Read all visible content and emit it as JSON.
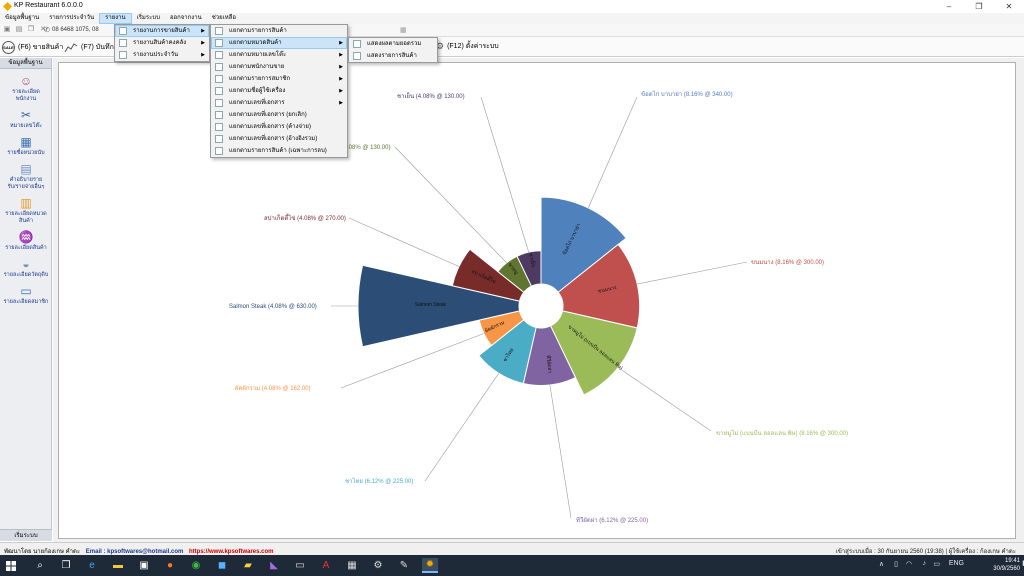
{
  "window": {
    "title": "KP Restaurant 6.0.0.0",
    "controls": [
      "–",
      "❐",
      "✕"
    ]
  },
  "menu": {
    "items": [
      "ข้อมูลพื้นฐาน",
      "รายการประจำวัน",
      "รายงาน",
      "เริ่มระบบ",
      "ออกจากงาน",
      "ช่วยเหลือ"
    ],
    "active_index": 2
  },
  "toolbar": {
    "phone": "08 6468 1075, 08",
    "f6_label": "(F6) ขายสินค้า",
    "f7_label": "(F7) บันทึก",
    "f12_label": "(F12) ตั้งค่าระบบ",
    "sale_badge": "SALE"
  },
  "report_menu": {
    "items": [
      {
        "label": "รายงานการขายสินค้า",
        "has_sub": true,
        "highlighted": true
      },
      {
        "label": "รายงานสินค้าคงคลัง",
        "has_sub": true,
        "highlighted": false
      },
      {
        "label": "รายงานประจำวัน",
        "has_sub": true,
        "highlighted": false
      }
    ]
  },
  "sales_menu": {
    "items": [
      {
        "label": "แยกตามรายการสินค้า",
        "has_sub": false,
        "highlighted": false
      },
      {
        "label": "แยกตามหมวดสินค้า",
        "has_sub": true,
        "highlighted": true
      },
      {
        "label": "แยกตามหมายเลขโต๊ะ",
        "has_sub": true,
        "highlighted": false
      },
      {
        "label": "แยกตามพนักงานขาย",
        "has_sub": true,
        "highlighted": false
      },
      {
        "label": "แยกตามรายการสมาชิก",
        "has_sub": true,
        "highlighted": false
      },
      {
        "label": "แยกตามชื่อผู้ใช้เครื่อง",
        "has_sub": true,
        "highlighted": false
      },
      {
        "label": "แยกตามเลขที่เอกสาร",
        "has_sub": true,
        "highlighted": false
      },
      {
        "label": "แยกตามเลขที่เอกสาร (ยกเลิก)",
        "has_sub": false,
        "highlighted": false
      },
      {
        "label": "แยกตามเลขที่เอกสาร (ค้างจ่าย)",
        "has_sub": false,
        "highlighted": false
      },
      {
        "label": "แยกตามเลขที่เอกสาร (อ้างอิงรวม)",
        "has_sub": false,
        "highlighted": false
      },
      {
        "label": "แยกตามรายการสินค้า (เฉพาะการลบ)",
        "has_sub": false,
        "highlighted": false
      }
    ]
  },
  "category_menu": {
    "items": [
      "แสดงผลตามยอดรวม",
      "แสดงรายการสินค้า"
    ]
  },
  "sidebar": {
    "header": "ข้อมูลพื้นฐาน",
    "items": [
      {
        "label": "รายละเอียด\nพนักงาน",
        "icon": "chef-icon"
      },
      {
        "label": "หมายเลขโต๊ะ",
        "icon": "utensils-icon"
      },
      {
        "label": "รายชื่อหน่วยนับ",
        "icon": "blocks-icon"
      },
      {
        "label": "คำอธิบายราย\nรับ/รายจ่ายอื่นๆ",
        "icon": "note-icon"
      },
      {
        "label": "รายละเอียดหมวด\nสินค้า",
        "icon": "folders-icon"
      },
      {
        "label": "รายละเอียดสินค้า",
        "icon": "wine-icon"
      },
      {
        "label": "รายละเอียดวัตถุดิบ",
        "icon": "bowl-icon"
      },
      {
        "label": "รายละเอียดสมาชิก",
        "icon": "card-icon"
      }
    ],
    "footer": "เริ่มระบบ"
  },
  "chart_data": {
    "type": "pie",
    "variant": "polar-area",
    "slices": [
      {
        "name": "ข้อดไก่ บาบาย่า",
        "percent": 8.16,
        "value": 340.0,
        "label": "ข้อดไก่ บาบาย่า (8.16% @ 340.00)",
        "color": "#4f81bd"
      },
      {
        "name": "ขนมนาง",
        "percent": 8.16,
        "value": 300.0,
        "label": "ขนมนาง (8.16% @ 300.00)",
        "color": "#c0504d"
      },
      {
        "name": "ขาหมูไม่ (แบนบีน ลอลแลน พิษ)",
        "percent": 8.16,
        "value": 300.0,
        "label": "ขาหมูไม่ (แบนบีน ลอลแลน พิษ) (8.16% @ 300.00)",
        "color": "#9bbb59"
      },
      {
        "name": "ทีวีผัดผ่า",
        "percent": 6.12,
        "value": 225.0,
        "label": "ทีวีผัดผ่า (6.12% @ 225.00)",
        "color": "#8064a2"
      },
      {
        "name": "ชาไทย",
        "percent": 6.12,
        "value": 225.0,
        "label": "ชาไทย (6.12% @ 225.00)",
        "color": "#4bacc6"
      },
      {
        "name": "ผัดผักรวม",
        "percent": 4.08,
        "value": 162.0,
        "label": "ผัดผักรวม (4.08% @ 162.00)",
        "color": "#f79646"
      },
      {
        "name": "Salmon Steak",
        "percent": 4.08,
        "value": 630.0,
        "label": "Salmon Steak (4.08% @ 630.00)",
        "color": "#2c4d75"
      },
      {
        "name": "สปาเก็ตตี้ไข่",
        "percent": 4.08,
        "value": 270.0,
        "label": "สปาเก็ตตี้ไข่ (4.08% @ 270.00)",
        "color": "#772c2a"
      },
      {
        "name": "ขาหมู",
        "percent": 4.08,
        "value": 130.0,
        "label": ".08% @ 130.00)",
        "color": "#5f7530"
      },
      {
        "name": "ชาเย็น",
        "percent": 4.08,
        "value": 130.0,
        "label": "ชาเย็น (4.08% @ 130.00)",
        "color": "#4d3b62"
      }
    ],
    "title": "",
    "legend": "none"
  },
  "status": {
    "developer": "พัฒนาโดย นายก้องเกษ คำดะ",
    "email": "Email : kpsoftwares@hotmail.com",
    "site": "https://www.kpsoftwares.com",
    "login": "เข้าสู่ระบบเมื่อ : 30 กันยายน 2560 (19:38)  |  ผู้ใช้เครื่อง : ก้องเกษ คำดะ"
  },
  "taskbar": {
    "time": "19:41",
    "date": "30/9/2560",
    "lang": "ENG"
  }
}
